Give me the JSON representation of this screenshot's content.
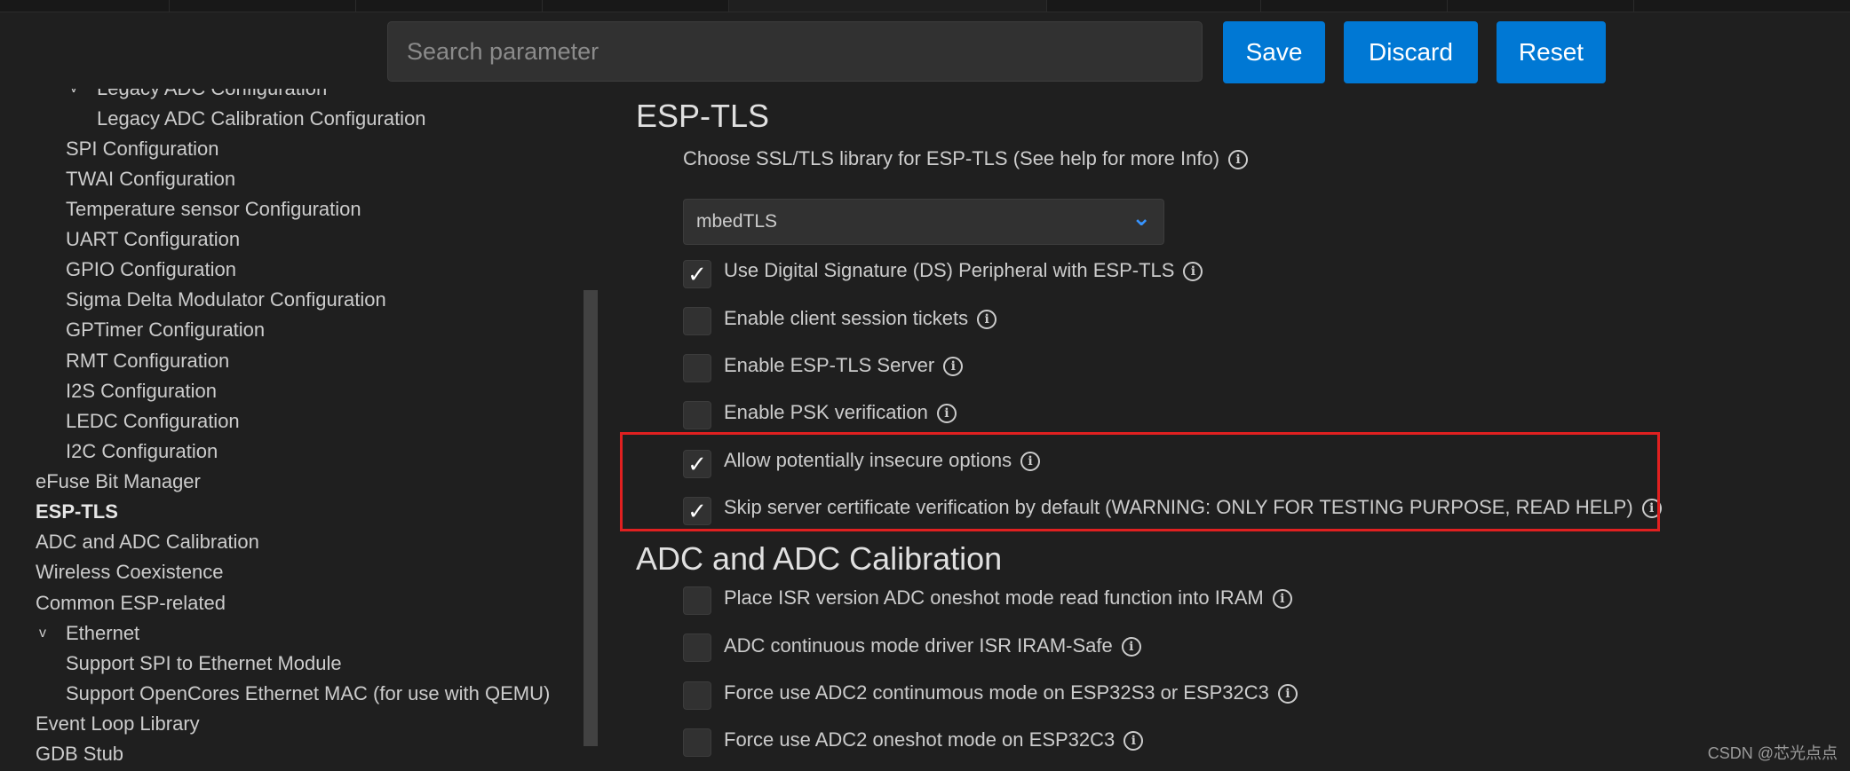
{
  "search": {
    "placeholder": "Search parameter"
  },
  "buttons": {
    "save": "Save",
    "discard": "Discard",
    "reset": "Reset"
  },
  "sidebar": {
    "items": [
      {
        "label": "Legacy ADC Configuration",
        "expanded": true
      },
      {
        "label": "Legacy ADC Calibration Configuration"
      },
      {
        "label": "SPI Configuration"
      },
      {
        "label": "TWAI Configuration"
      },
      {
        "label": "Temperature sensor Configuration"
      },
      {
        "label": "UART Configuration"
      },
      {
        "label": "GPIO Configuration"
      },
      {
        "label": "Sigma Delta Modulator Configuration"
      },
      {
        "label": "GPTimer Configuration"
      },
      {
        "label": "RMT Configuration"
      },
      {
        "label": "I2S Configuration"
      },
      {
        "label": "LEDC Configuration"
      },
      {
        "label": "I2C Configuration"
      },
      {
        "label": "eFuse Bit Manager"
      },
      {
        "label": "ESP-TLS",
        "selected": true
      },
      {
        "label": "ADC and ADC Calibration"
      },
      {
        "label": "Wireless Coexistence"
      },
      {
        "label": "Common ESP-related"
      },
      {
        "label": "Ethernet",
        "expanded": true
      },
      {
        "label": "Support SPI to Ethernet Module"
      },
      {
        "label": "Support OpenCores Ethernet MAC (for use with QEMU)"
      },
      {
        "label": "Event Loop Library"
      },
      {
        "label": "GDB Stub"
      }
    ]
  },
  "main": {
    "esp_tls": {
      "title": "ESP-TLS",
      "library_label": "Choose SSL/TLS library for ESP-TLS (See help for more Info)",
      "library_value": "mbedTLS",
      "options": [
        {
          "label": "Use Digital Signature (DS) Peripheral with ESP-TLS",
          "checked": true
        },
        {
          "label": "Enable client session tickets",
          "checked": false
        },
        {
          "label": "Enable ESP-TLS Server",
          "checked": false
        },
        {
          "label": "Enable PSK verification",
          "checked": false
        },
        {
          "label": "Allow potentially insecure options",
          "checked": true
        },
        {
          "label": "Skip server certificate verification by default (WARNING: ONLY FOR TESTING PURPOSE, READ HELP)",
          "checked": true
        }
      ]
    },
    "adc": {
      "title": "ADC and ADC Calibration",
      "options": [
        {
          "label": "Place ISR version ADC oneshot mode read function into IRAM",
          "checked": false
        },
        {
          "label": "ADC continuous mode driver ISR IRAM-Safe",
          "checked": false
        },
        {
          "label": "Force use ADC2 continumous mode on ESP32S3 or ESP32C3",
          "checked": false
        },
        {
          "label": "Force use ADC2 oneshot mode on ESP32C3",
          "checked": false
        }
      ]
    }
  },
  "icons": {
    "check": "✓",
    "info": "i",
    "chevron_down": "⌄",
    "tree_chevron": "v"
  },
  "watermark": "CSDN @芯光点点",
  "colors": {
    "background": "#1f1f1f",
    "accent": "#0078d4",
    "highlight": "#e02020",
    "select_chevron": "#3794ff"
  }
}
